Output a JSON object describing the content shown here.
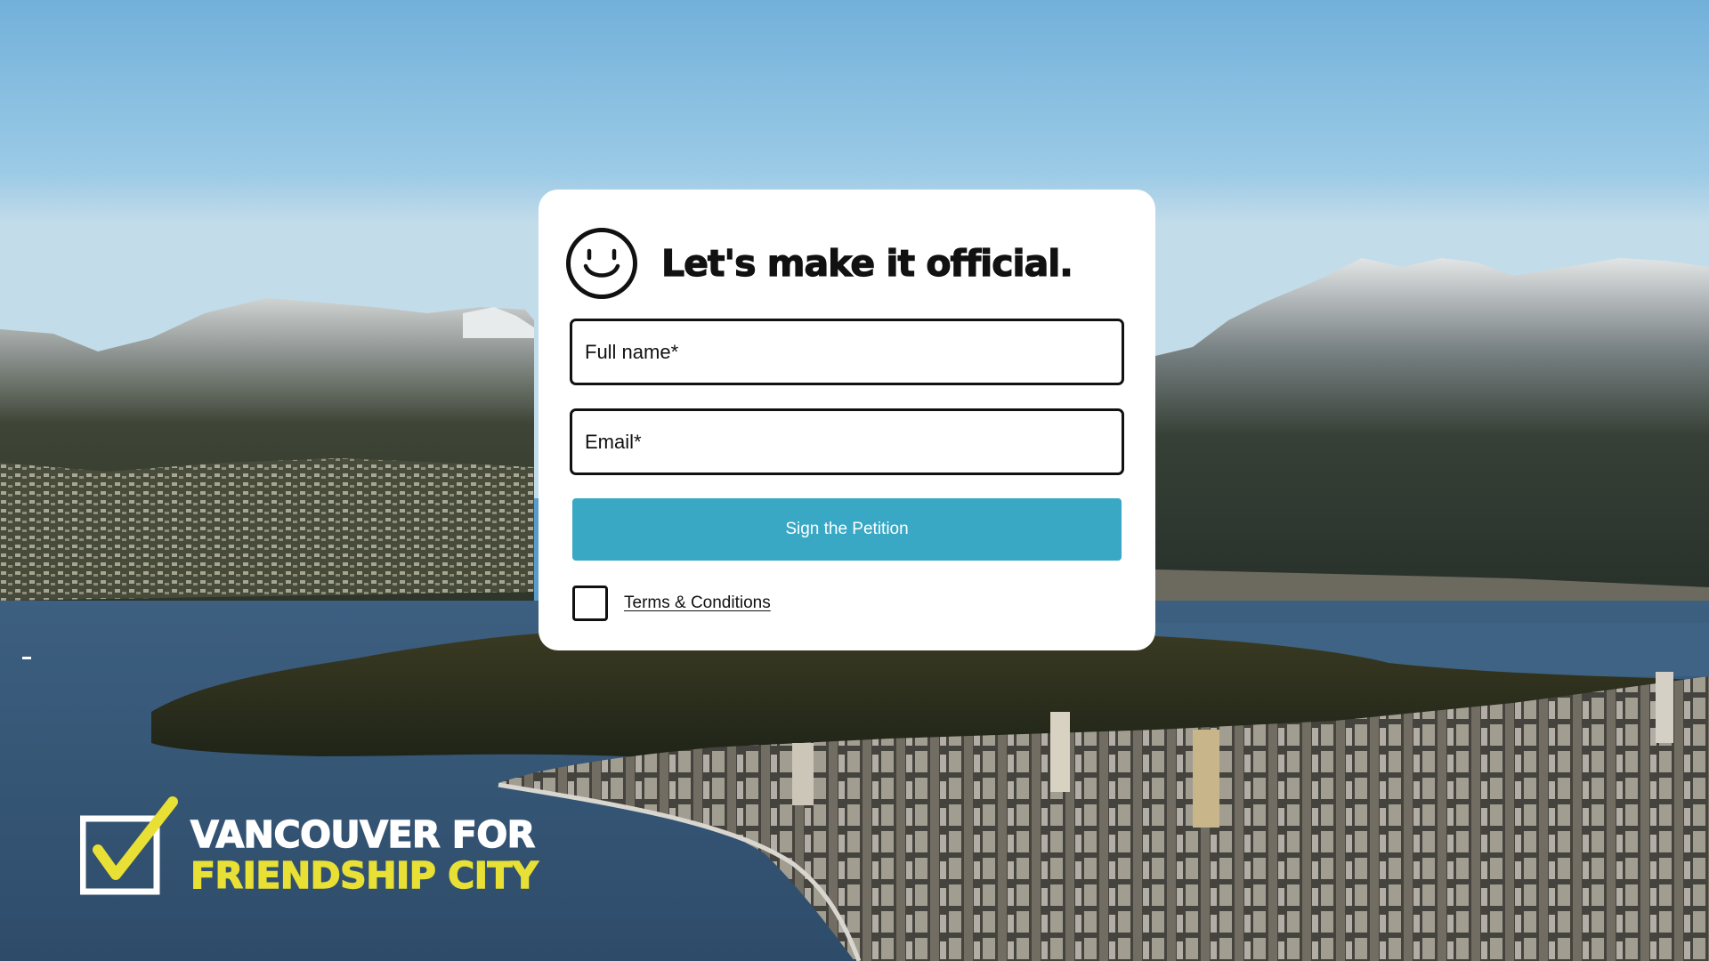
{
  "form": {
    "title": "Let's make it official.",
    "full_name_placeholder": "Full name*",
    "email_placeholder": "Email*",
    "submit_label": "Sign the Petition",
    "terms_label": "Terms & Conditions",
    "terms_checked": false
  },
  "logo": {
    "line_1": "VANCOUVER FOR",
    "line_2": "FRIENDSHIP CITY"
  },
  "icons": {
    "header": "smiley-icon",
    "logo": "checkbox-check-icon"
  },
  "colors": {
    "button": "#38a8c5",
    "logo_accent": "#e8e034",
    "card": "#ffffff",
    "text": "#111111"
  }
}
